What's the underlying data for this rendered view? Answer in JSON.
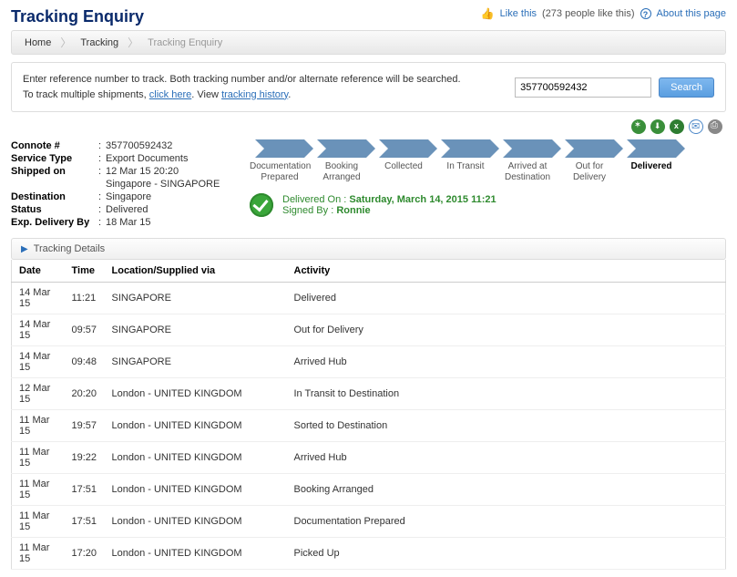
{
  "header": {
    "title": "Tracking Enquiry",
    "like_label": "Like this",
    "like_count_text": "(273 people like this)",
    "about_label": "About this page"
  },
  "breadcrumb": {
    "items": [
      "Home",
      "Tracking",
      "Tracking Enquiry"
    ]
  },
  "search": {
    "line1": "Enter reference number to track. Both tracking number and/or alternate reference will be searched.",
    "line2a": "To track multiple shipments, ",
    "line2_link1": "click here",
    "line2b": ". View ",
    "line2_link2": "tracking history",
    "line2c": ".",
    "input_value": "357700592432",
    "button": "Search"
  },
  "connote": {
    "labels": {
      "connote": "Connote #",
      "service": "Service Type",
      "shipped": "Shipped on",
      "destination": "Destination",
      "status": "Status",
      "expected": "Exp. Delivery By"
    },
    "values": {
      "connote": "357700592432",
      "service": "Export Documents",
      "shipped_time": "12 Mar 15 20:20",
      "shipped_loc": "Singapore - SINGAPORE",
      "destination": "Singapore",
      "status": "Delivered",
      "expected": "18 Mar 15"
    }
  },
  "stages": [
    {
      "label": "Documentation Prepared"
    },
    {
      "label": "Booking Arranged"
    },
    {
      "label": "Collected"
    },
    {
      "label": "In Transit"
    },
    {
      "label": "Arrived at Destination"
    },
    {
      "label": "Out for Delivery"
    },
    {
      "label": "Delivered",
      "current": true
    }
  ],
  "delivered": {
    "on_label": "Delivered On :",
    "on_value": "Saturday, March 14, 2015 11:21",
    "signed_label": "Signed By :",
    "signed_value": "Ronnie"
  },
  "section_title": "Tracking Details",
  "table": {
    "headers": [
      "Date",
      "Time",
      "Location/Supplied via",
      "Activity"
    ],
    "rows": [
      [
        "14 Mar 15",
        "11:21",
        "SINGAPORE",
        "Delivered"
      ],
      [
        "14 Mar 15",
        "09:57",
        "SINGAPORE",
        "Out for Delivery"
      ],
      [
        "14 Mar 15",
        "09:48",
        "SINGAPORE",
        "Arrived Hub"
      ],
      [
        "12 Mar 15",
        "20:20",
        "London - UNITED KINGDOM",
        "In Transit to Destination"
      ],
      [
        "11 Mar 15",
        "19:57",
        "London - UNITED KINGDOM",
        "Sorted to Destination"
      ],
      [
        "11 Mar 15",
        "19:22",
        "London - UNITED KINGDOM",
        "Arrived Hub"
      ],
      [
        "11 Mar 15",
        "17:51",
        "London - UNITED KINGDOM",
        "Booking Arranged"
      ],
      [
        "11 Mar 15",
        "17:51",
        "London - UNITED KINGDOM",
        "Documentation Prepared"
      ],
      [
        "11 Mar 15",
        "17:20",
        "London - UNITED KINGDOM",
        "Picked Up"
      ]
    ]
  }
}
